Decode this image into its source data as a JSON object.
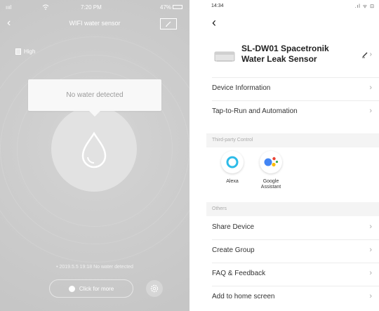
{
  "left": {
    "status": {
      "signal": "ıııl",
      "time": "7:20 PM",
      "battery": "47%"
    },
    "title": "WIFI water sensor",
    "battery_level": "High",
    "status_message": "No water detected",
    "history": "• 2019.5.5 19:18 No water detected",
    "click_more": "Click for more"
  },
  "right": {
    "status": {
      "time": "14:34",
      "icons": ".ıl ᯤ ⊡"
    },
    "device": {
      "name_line1": "SL-DW01 Spacetronik",
      "name_line2": "Water Leak Sensor"
    },
    "menu_top": [
      {
        "label": "Device Information"
      },
      {
        "label": "Tap-to-Run and Automation"
      }
    ],
    "third_party": {
      "header": "Third-party Control",
      "items": [
        {
          "name": "Alexa"
        },
        {
          "name_line1": "Google",
          "name_line2": "Assistant"
        }
      ]
    },
    "others": {
      "header": "Others",
      "items": [
        {
          "label": "Share Device"
        },
        {
          "label": "Create Group"
        },
        {
          "label": "FAQ & Feedback"
        },
        {
          "label": "Add to home screen"
        }
      ]
    },
    "colors": {
      "alexa": "#2dbbe8",
      "google_blue": "#4285f4",
      "google_red": "#ea4335",
      "google_yellow": "#fbbc05",
      "google_green": "#34a853"
    }
  }
}
